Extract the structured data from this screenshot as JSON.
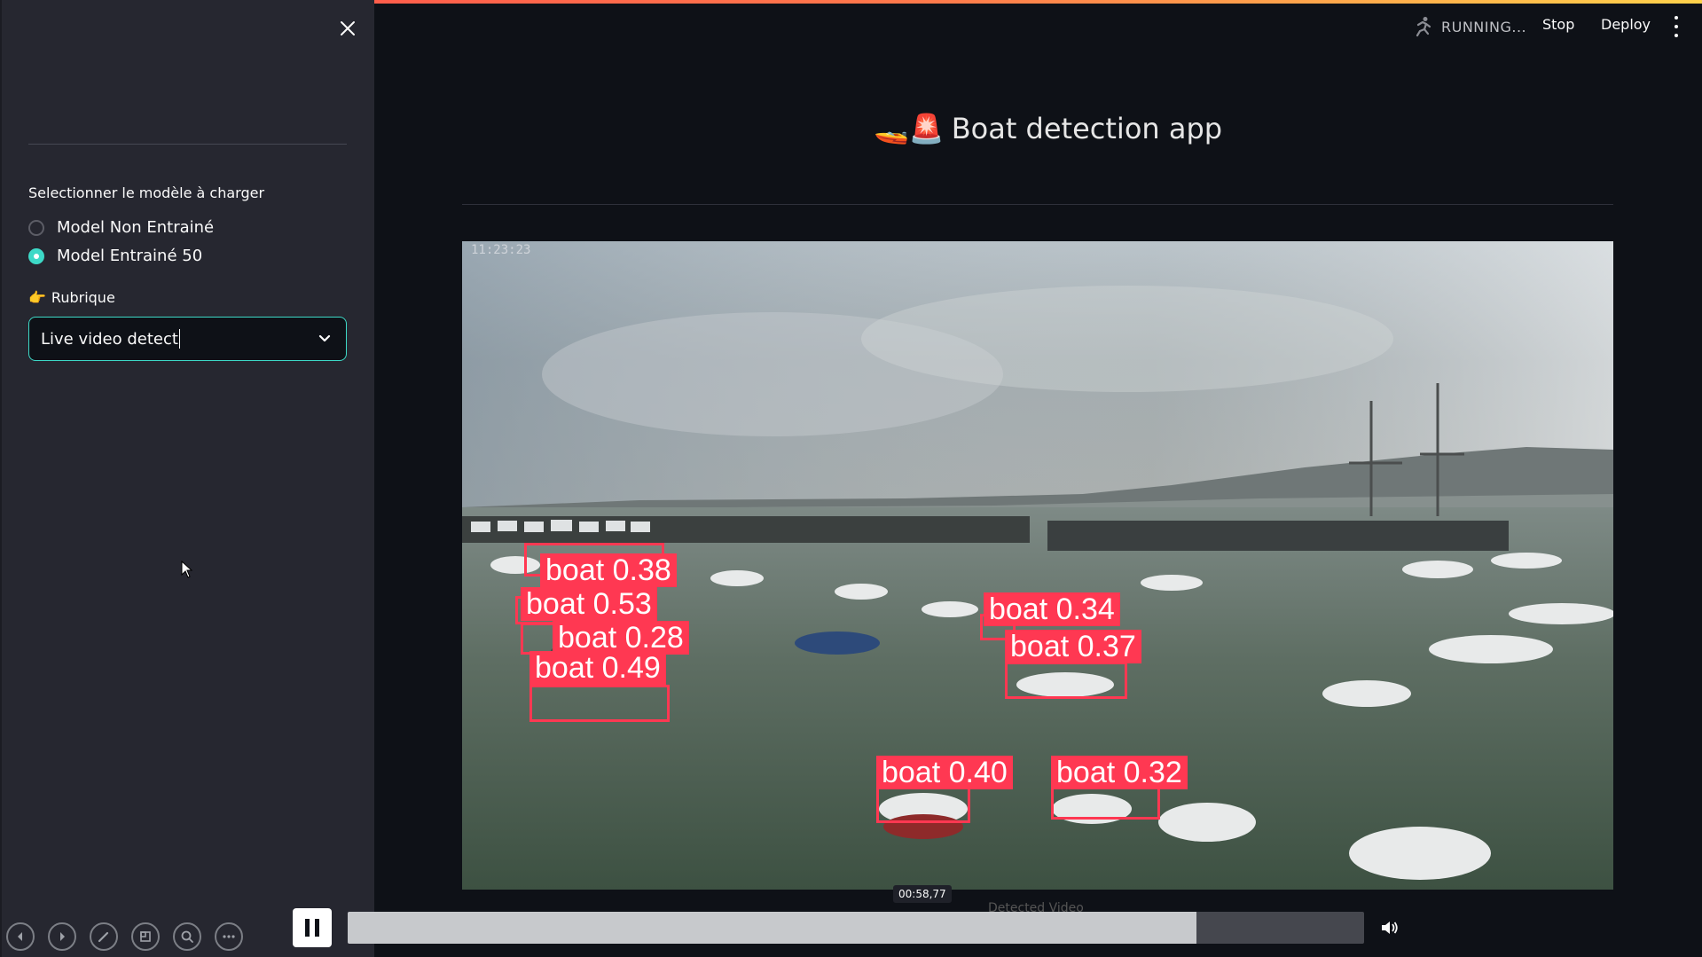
{
  "header": {
    "status": "RUNNING...",
    "stop_label": "Stop",
    "deploy_label": "Deploy"
  },
  "sidebar": {
    "model_label": "Selectionner le modèle à charger",
    "radio_options": [
      {
        "label": "Model Non Entrainé",
        "selected": false
      },
      {
        "label": "Model Entrainé 50",
        "selected": true
      }
    ],
    "rubrique_emoji": "👉",
    "rubrique_label": "Rubrique",
    "select_value": "Live video detect"
  },
  "main": {
    "title_emojis": "🚤🚨",
    "title": "Boat detection app",
    "video_timestamp": "11:23:23",
    "detections": [
      {
        "label": "boat 0.38"
      },
      {
        "label": "boat 0.53"
      },
      {
        "label": "boat 0.28"
      },
      {
        "label": "boat 0.49"
      },
      {
        "label": "boat 0.34"
      },
      {
        "label": "boat 0.37"
      },
      {
        "label": "boat 0.40"
      },
      {
        "label": "boat 0.32"
      }
    ],
    "caption": "Detected Video"
  },
  "player": {
    "current_time": "00:58,77",
    "progress_fraction": 0.835
  },
  "colors": {
    "accent": "#3dd9c7",
    "bbox": "#ff3852",
    "sidebar_bg": "#262730",
    "app_bg": "#0e1117"
  }
}
